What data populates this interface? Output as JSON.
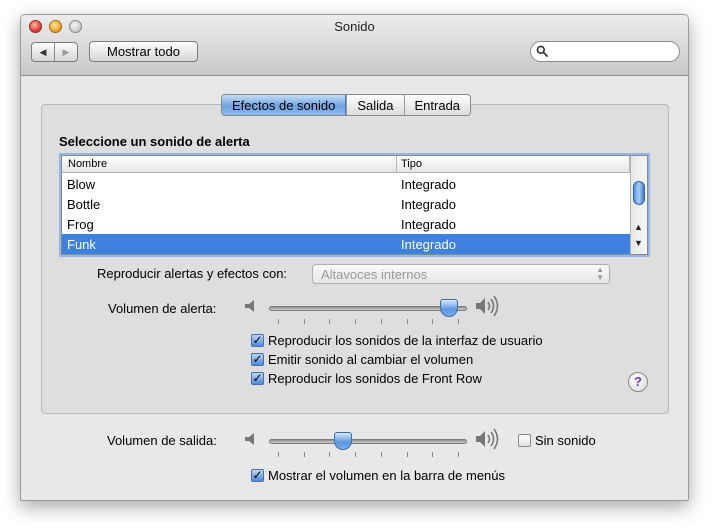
{
  "window": {
    "title": "Sonido"
  },
  "toolbar": {
    "back_glyph": "◀",
    "forward_glyph": "▶",
    "show_all_label": "Mostrar todo",
    "search_placeholder": "",
    "search_value": ""
  },
  "tabs": [
    {
      "label": "Efectos de sonido",
      "active": true
    },
    {
      "label": "Salida",
      "active": false
    },
    {
      "label": "Entrada",
      "active": false
    }
  ],
  "effects": {
    "section_label": "Seleccione un sonido de alerta",
    "columns": [
      "Nombre",
      "Tipo"
    ],
    "rows": [
      {
        "name": "Blow",
        "type": "Integrado",
        "selected": false
      },
      {
        "name": "Bottle",
        "type": "Integrado",
        "selected": false
      },
      {
        "name": "Frog",
        "type": "Integrado",
        "selected": false
      },
      {
        "name": "Funk",
        "type": "Integrado",
        "selected": true
      }
    ],
    "play_through_label": "Reproducir alertas y efectos con:",
    "play_through_value": "Altavoces internos",
    "alert_volume_label": "Volumen de alerta:",
    "alert_volume_level": 0.95,
    "checkboxes": [
      {
        "label": "Reproducir los sonidos de la interfaz de usuario",
        "checked": true
      },
      {
        "label": "Emitir sonido al cambiar el volumen",
        "checked": true
      },
      {
        "label": "Reproducir los sonidos de Front Row",
        "checked": true
      }
    ],
    "help_glyph": "?"
  },
  "output": {
    "volume_label": "Volumen de salida:",
    "volume_level": 0.36,
    "mute_label": "Sin sonido",
    "mute_checked": false,
    "menu_bar_label": "Mostrar el volumen en la barra de menús",
    "menu_bar_checked": true
  },
  "colors": {
    "selection": "#3d80df",
    "accent": "#6ea3e0",
    "help": "#6b3bb5"
  }
}
